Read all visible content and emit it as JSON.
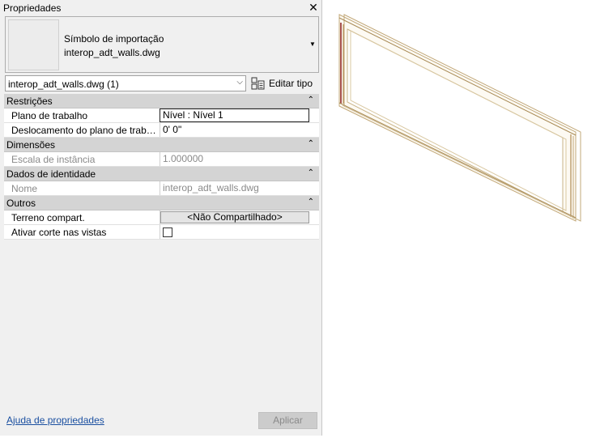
{
  "panel": {
    "title": "Propriedades",
    "close_glyph": "✕",
    "type_selector": {
      "line1": "Símbolo de importação",
      "line2": "interop_adt_walls.dwg",
      "arrow": "▼"
    },
    "instance_selector": {
      "value": "interop_adt_walls.dwg (1)",
      "arrow": "⌵"
    },
    "edit_type_label": "Editar tipo",
    "groups": [
      {
        "title": "Restrições",
        "collapse": "⌃",
        "rows": [
          {
            "label": "Plano de trabalho",
            "value": "Nível : Nível 1"
          },
          {
            "label": "Deslocamento do plano de trabalho",
            "value": "0'  0\""
          }
        ]
      },
      {
        "title": "Dimensões",
        "collapse": "⌃",
        "rows": [
          {
            "label": "Escala de instância",
            "value": "1.000000"
          }
        ]
      },
      {
        "title": "Dados de identidade",
        "collapse": "⌃",
        "rows": [
          {
            "label": "Nome",
            "value": "interop_adt_walls.dwg"
          }
        ]
      },
      {
        "title": "Outros",
        "collapse": "⌃",
        "rows": [
          {
            "label": "Terreno compart.",
            "value": "<Não Compartilhado>"
          },
          {
            "label": "Ativar corte nas vistas",
            "value": ""
          }
        ]
      }
    ],
    "help_link": "Ajuda de propriedades",
    "apply_label": "Aplicar"
  },
  "icons": {
    "close": "close-icon",
    "edit_type": "edit-type-icon",
    "dropdown": "chevron-down-icon",
    "collapse": "collapse-up-icon"
  },
  "colors": {
    "panel_bg": "#f0f0f0",
    "group_bg": "#d4d4d4",
    "link": "#1a4fa0",
    "wall_edge": "#b08850",
    "wall_accent": "#8b1a1a"
  }
}
